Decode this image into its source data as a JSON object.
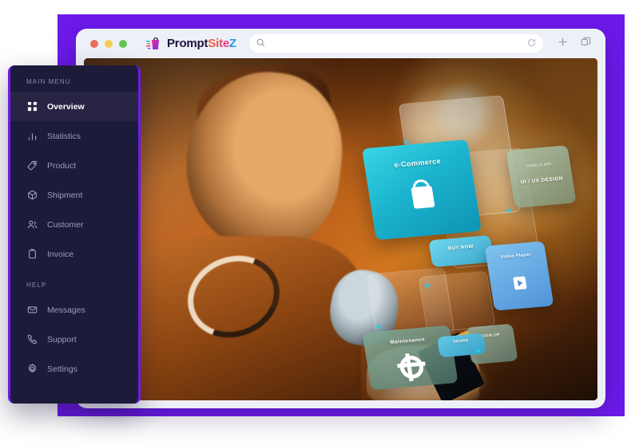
{
  "browser": {
    "window_dots": [
      "red",
      "yellow",
      "green"
    ],
    "logo": {
      "part1": "Prompt",
      "part2": "Site",
      "part3": "Z",
      "mark": "shopping-bag-logo"
    },
    "search": {
      "value": "",
      "placeholder": ""
    },
    "icons": {
      "search": "search-icon",
      "reload": "reload-icon",
      "new_tab": "plus-icon",
      "tabs": "copy-tabs-icon"
    }
  },
  "sidebar": {
    "sections": [
      {
        "title": "MAIN MENU",
        "items": [
          {
            "label": "Overview",
            "icon": "grid-icon",
            "active": true
          },
          {
            "label": "Statistics",
            "icon": "bar-chart-icon",
            "active": false
          },
          {
            "label": "Product",
            "icon": "tag-icon",
            "active": false
          },
          {
            "label": "Shipment",
            "icon": "package-icon",
            "active": false
          },
          {
            "label": "Customer",
            "icon": "users-icon",
            "active": false
          },
          {
            "label": "Invoice",
            "icon": "clipboard-icon",
            "active": false
          }
        ]
      },
      {
        "title": "HELP",
        "items": [
          {
            "label": "Messages",
            "icon": "mail-icon",
            "active": false
          },
          {
            "label": "Support",
            "icon": "phone-icon",
            "active": false
          },
          {
            "label": "Settings",
            "icon": "gear-icon",
            "active": false
          }
        ]
      }
    ]
  },
  "scene": {
    "description": "man-with-headphones-using-phone",
    "cards": [
      {
        "label": "e-Commerce",
        "sub": "",
        "icon": "shopping-bag-icon"
      },
      {
        "label": "UI / UX DESIGN",
        "sub": "MOBILE APP",
        "icon": ""
      },
      {
        "label": "BUY NOW",
        "sub": "",
        "icon": ""
      },
      {
        "label": "Video Player",
        "sub": "",
        "icon": "play-icon"
      },
      {
        "label": "Maintenance",
        "sub": "",
        "icon": "gear-icon"
      },
      {
        "label": "SIGN UP",
        "sub": "",
        "icon": ""
      },
      {
        "label": "SHARE",
        "sub": "",
        "icon": ""
      }
    ]
  },
  "colors": {
    "frame_purple": "#6d1aec",
    "sidebar_bg": "#1d1b3a",
    "sidebar_active": "#282544",
    "chrome_bg": "#eef0f7",
    "accent_teal": "#1bb4cf"
  }
}
